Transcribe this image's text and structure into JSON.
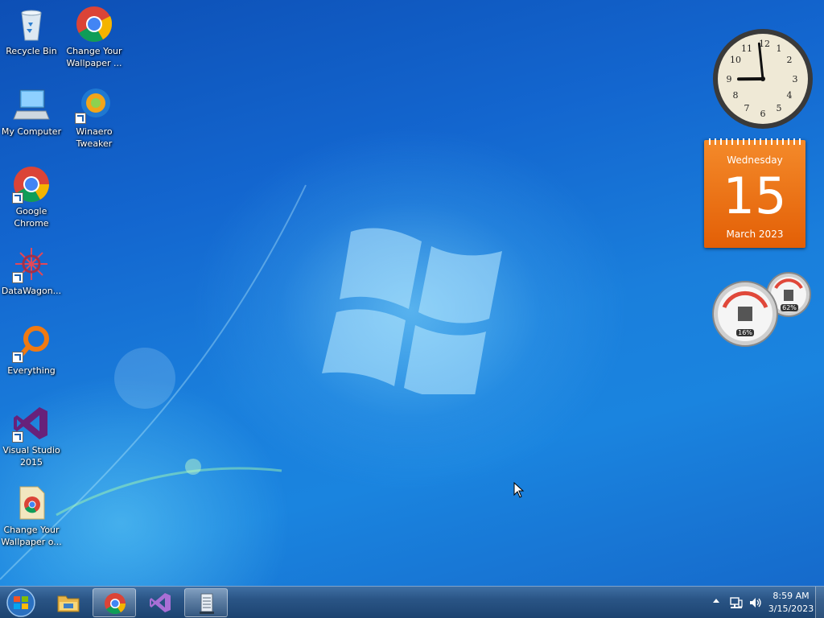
{
  "desktop": {
    "icons": [
      {
        "label": "Recycle Bin"
      },
      {
        "label": "Change Your Wallpaper ..."
      },
      {
        "label": "My Computer"
      },
      {
        "label": "Winaero Tweaker"
      },
      {
        "label": "Google Chrome"
      },
      {
        "label": "DataWagon..."
      },
      {
        "label": "Everything"
      },
      {
        "label": "Visual Studio 2015"
      },
      {
        "label": "Change Your Wallpaper o..."
      }
    ]
  },
  "gadgets": {
    "clock": {
      "hour": 8,
      "minute": 59
    },
    "calendar": {
      "weekday": "Wednesday",
      "day": "15",
      "month_year": "March 2023"
    },
    "cpu_meter": {
      "cpu": "16%",
      "memory": "62%"
    }
  },
  "taskbar": {
    "pinned": [
      "file-explorer",
      "google-chrome",
      "visual-studio",
      "notepad"
    ],
    "active": "google-chrome",
    "clock": {
      "time": "8:59 AM",
      "date": "3/15/2023"
    }
  },
  "colors": {
    "accent": "#1a7fdc",
    "calendar": "#e8680c"
  }
}
